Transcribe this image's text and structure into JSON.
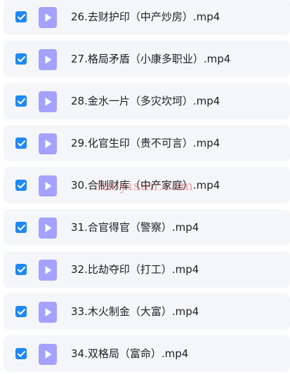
{
  "colors": {
    "accent": "#1e88f5",
    "icon": "#a5a1ff",
    "row_bg": "#f5f6fa"
  },
  "files": [
    {
      "name": "26.去财护印（中产炒房）.mp4",
      "checked": true
    },
    {
      "name": "27.格局矛盾（小康多职业）.mp4",
      "checked": true
    },
    {
      "name": "28.金水一片（多灾坎坷）.mp4",
      "checked": true
    },
    {
      "name": "29.化官生印（贵不可言）.mp4",
      "checked": true
    },
    {
      "name": "30.合制财库（中产家庭）.mp4",
      "checked": true
    },
    {
      "name": "31.合官得官（警察）.mp4",
      "checked": true
    },
    {
      "name": "32.比劫夺印（打工）.mp4",
      "checked": true
    },
    {
      "name": "33.木火制金（大富）.mp4",
      "checked": true
    },
    {
      "name": "34.双格局（富命）.mp4",
      "checked": true
    }
  ],
  "watermark": "luoyisan.com"
}
